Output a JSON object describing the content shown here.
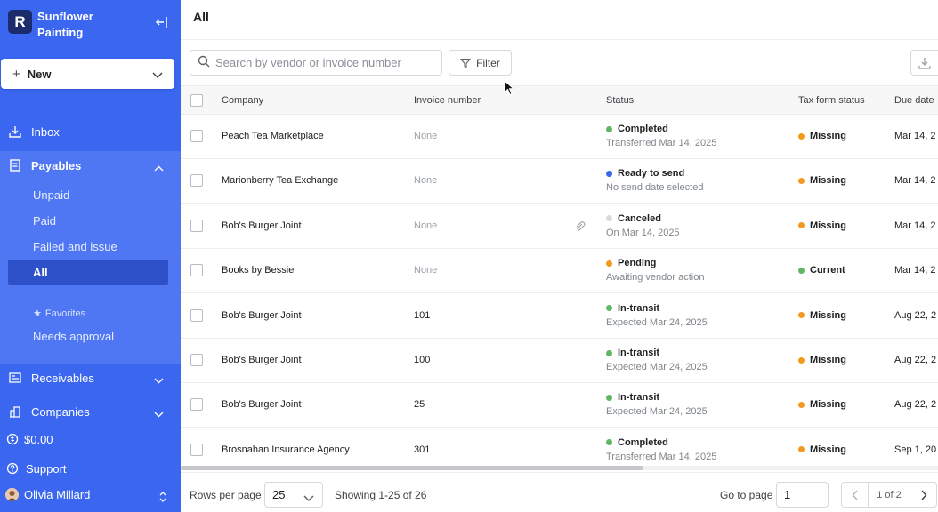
{
  "sidebar": {
    "brand_initial": "R",
    "brand_name": "Sunflower Painting",
    "new_label": "New",
    "inbox": "Inbox",
    "payables": "Payables",
    "payables_sub": [
      "Unpaid",
      "Paid",
      "Failed and issue",
      "All"
    ],
    "favorites_label": "Favorites",
    "needs_approval": "Needs approval",
    "receivables": "Receivables",
    "companies": "Companies",
    "balance": "$0.00",
    "support": "Support",
    "user_name": "Olivia Millard"
  },
  "header": {
    "title": "All"
  },
  "toolbar": {
    "search_placeholder": "Search by vendor or invoice number",
    "filter_label": "Filter"
  },
  "table": {
    "columns": [
      "Company",
      "Invoice number",
      "Status",
      "Tax form status",
      "Due date"
    ],
    "rows": [
      {
        "company": "Peach Tea Marketplace",
        "invoice": "None",
        "status": "Completed",
        "status_color": "#5fb862",
        "status_sub": "Transferred Mar 14, 2025",
        "tax": "Missing",
        "tax_color": "#f29a20",
        "due": "Mar 14, 2"
      },
      {
        "company": "Marionberry Tea Exchange",
        "invoice": "None",
        "status": "Ready to send",
        "status_color": "#3a66f0",
        "status_sub": "No send date selected",
        "tax": "Missing",
        "tax_color": "#f29a20",
        "due": "Mar 14, 2"
      },
      {
        "company": "Bob's Burger Joint",
        "invoice": "None",
        "status": "Canceled",
        "status_color": "#d8dadd",
        "status_sub": "On Mar 14, 2025",
        "tax": "Missing",
        "tax_color": "#f29a20",
        "due": "Mar 14, 2",
        "attachment": true
      },
      {
        "company": "Books by Bessie",
        "invoice": "None",
        "status": "Pending",
        "status_color": "#f29a20",
        "status_sub": "Awaiting vendor action",
        "tax": "Current",
        "tax_color": "#5fb862",
        "due": "Mar 14, 2"
      },
      {
        "company": "Bob's Burger Joint",
        "invoice": "101",
        "status": "In-transit",
        "status_color": "#5fb862",
        "status_sub": "Expected Mar 24, 2025",
        "tax": "Missing",
        "tax_color": "#f29a20",
        "due": "Aug 22, 2"
      },
      {
        "company": "Bob's Burger Joint",
        "invoice": "100",
        "status": "In-transit",
        "status_color": "#5fb862",
        "status_sub": "Expected Mar 24, 2025",
        "tax": "Missing",
        "tax_color": "#f29a20",
        "due": "Aug 22, 2"
      },
      {
        "company": "Bob's Burger Joint",
        "invoice": "25",
        "status": "In-transit",
        "status_color": "#5fb862",
        "status_sub": "Expected Mar 24, 2025",
        "tax": "Missing",
        "tax_color": "#f29a20",
        "due": "Aug 22, 2"
      },
      {
        "company": "Brosnahan Insurance Agency",
        "invoice": "301",
        "status": "Completed",
        "status_color": "#5fb862",
        "status_sub": "Transferred Mar 14, 2025",
        "tax": "Missing",
        "tax_color": "#f29a20",
        "due": "Sep 1, 20"
      }
    ]
  },
  "footer": {
    "rows_per_page_label": "Rows per page",
    "rows_per_page": "25",
    "showing": "Showing 1-25 of 26",
    "goto_label": "Go to page",
    "goto_value": "1",
    "page_info": "1 of 2"
  },
  "colors": {
    "sidebar": "#3a66f0",
    "sidebar_active": "#2e51c9",
    "success": "#5fb862",
    "warning": "#f29a20"
  }
}
